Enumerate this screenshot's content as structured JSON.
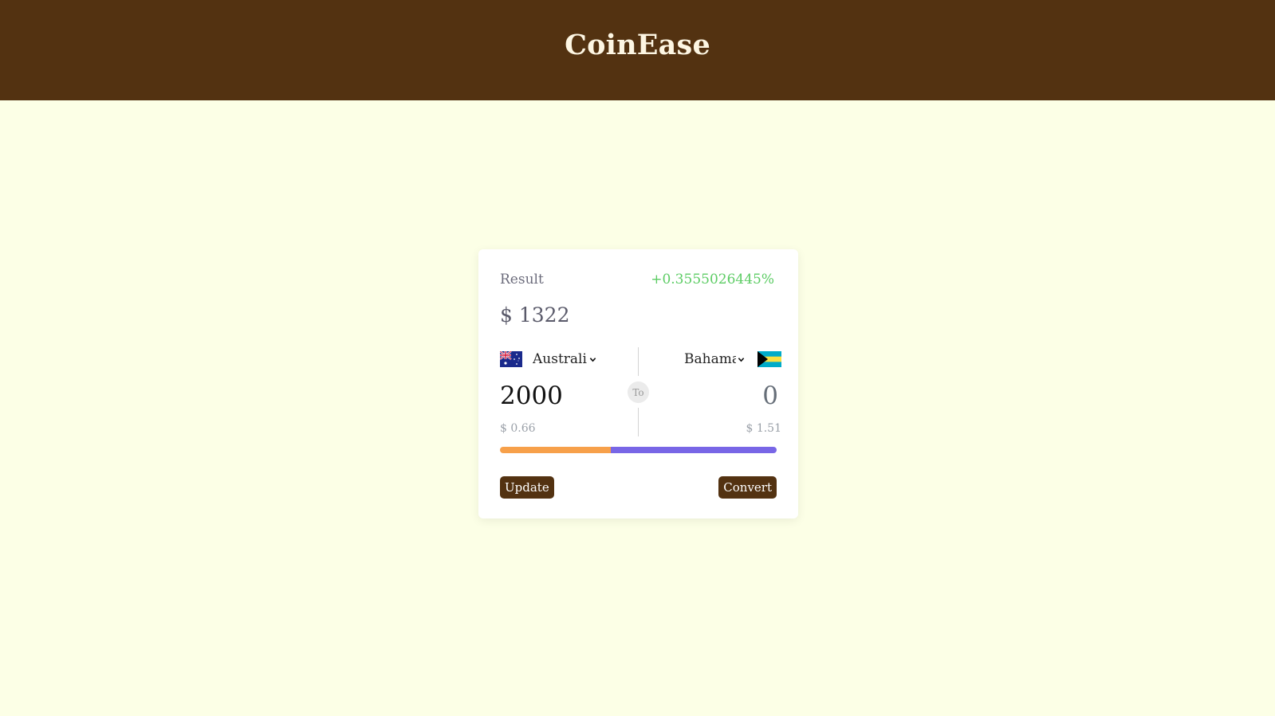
{
  "header": {
    "title": "CoinEase"
  },
  "card": {
    "result_label": "Result",
    "change_percent": "+0.3555026445%",
    "result_value": "$ 1322",
    "divider_badge": "To",
    "from": {
      "currency": "Australi",
      "flag": "australia-flag",
      "amount": "2000",
      "rate": "$ 0.66",
      "bar_color": "#f7a04a"
    },
    "to": {
      "currency": "Bahama",
      "flag": "bahamas-flag",
      "amount": "0",
      "rate": "$ 1.51",
      "bar_color": "#7866e6"
    },
    "ratio_bar": {
      "from_fraction": 0.4
    },
    "buttons": {
      "update": "Update",
      "convert": "Convert"
    }
  },
  "colors": {
    "header_bg": "#533211",
    "page_bg": "#fcffe6",
    "accent_positive": "#5ccc64",
    "button_bg": "#533211"
  }
}
